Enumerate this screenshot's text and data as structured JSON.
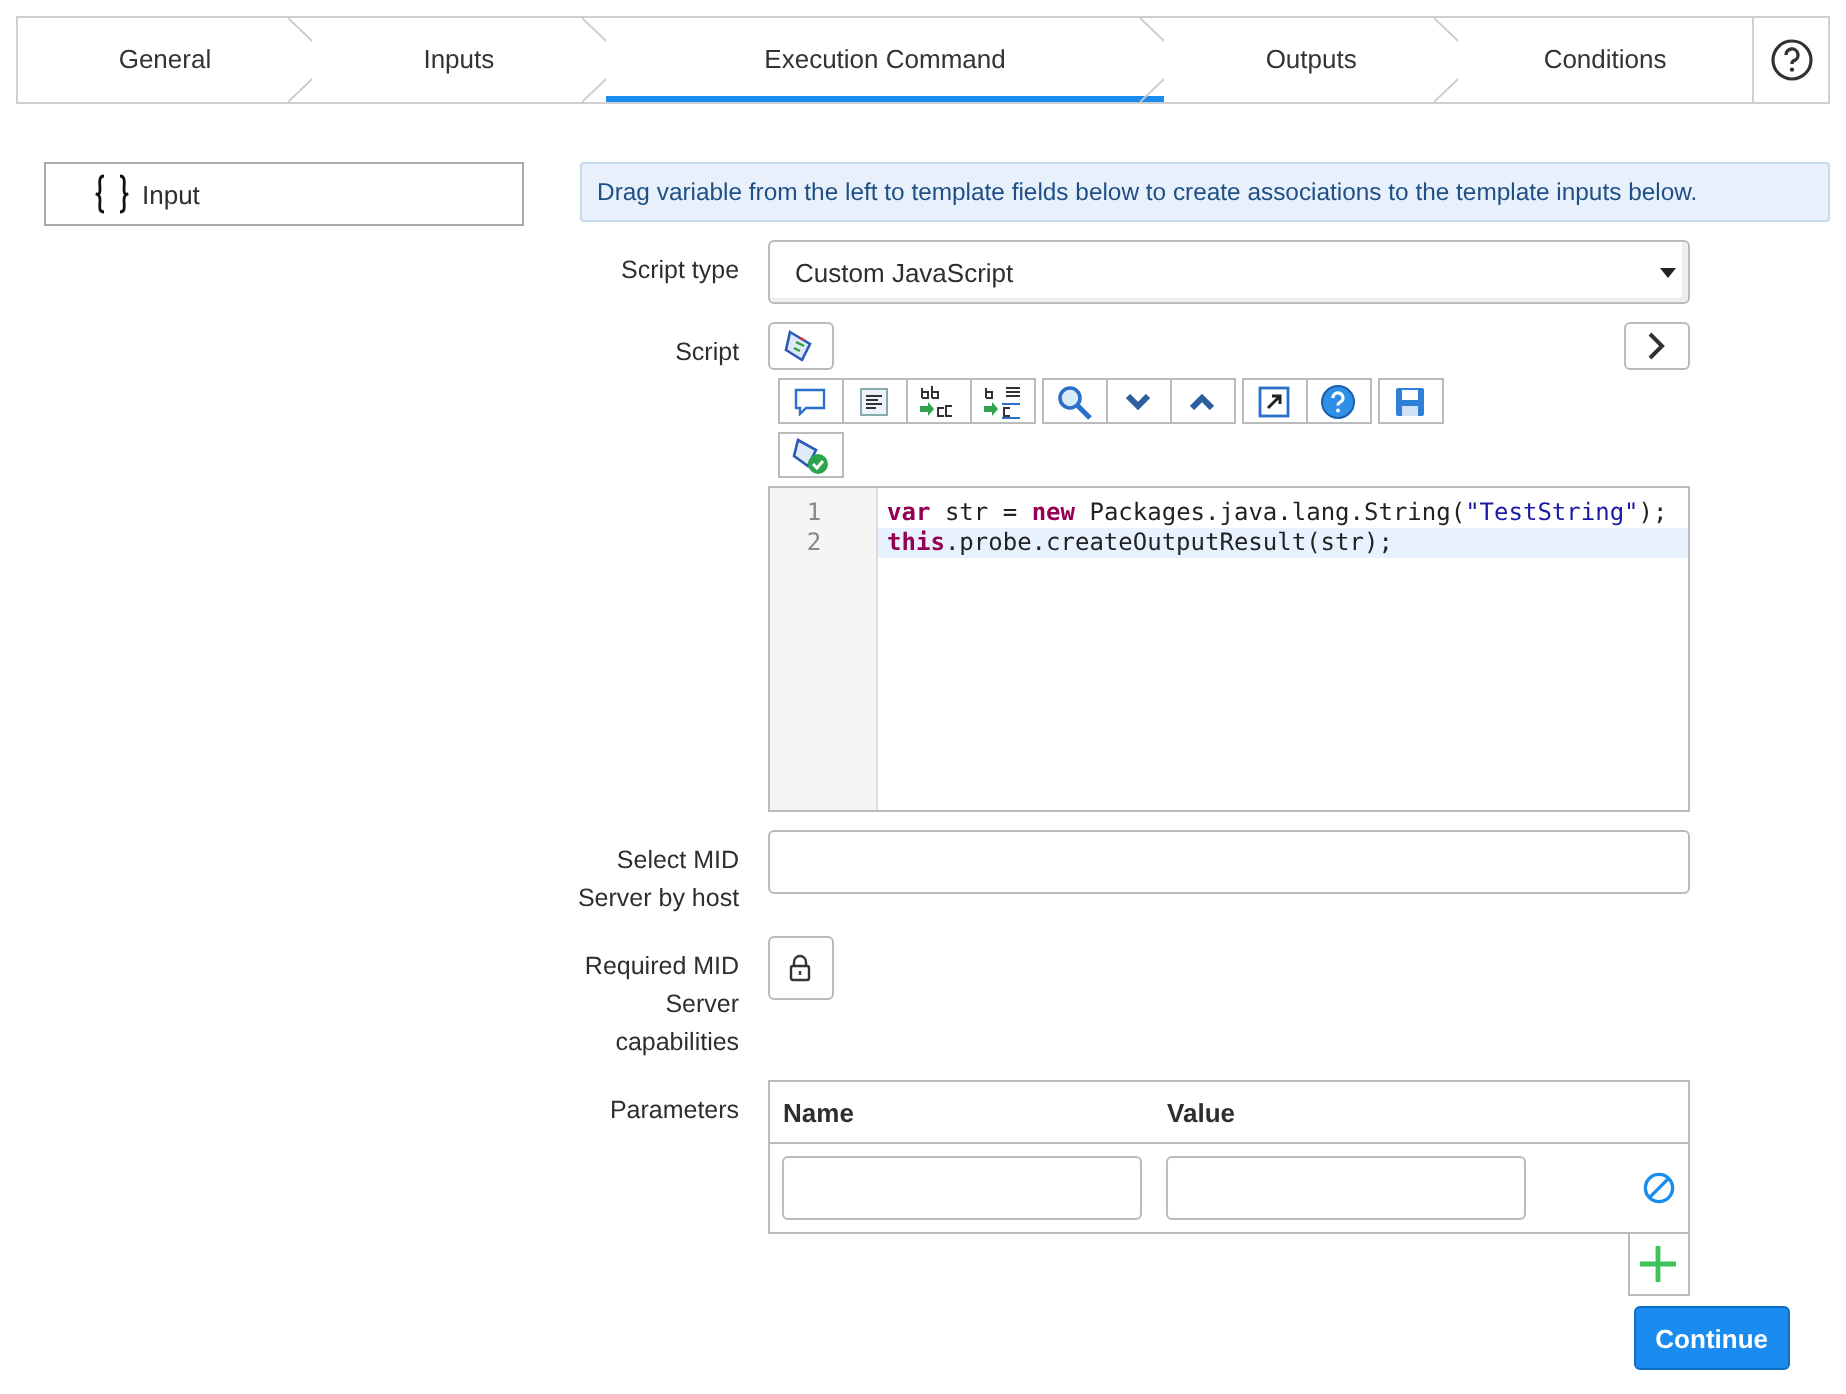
{
  "tabs": [
    {
      "label": "General",
      "selected": false
    },
    {
      "label": "Inputs",
      "selected": false
    },
    {
      "label": "Execution Command",
      "selected": true
    },
    {
      "label": "Outputs",
      "selected": false
    },
    {
      "label": "Conditions",
      "selected": false
    }
  ],
  "variables": [
    {
      "label": "Input"
    }
  ],
  "info_message": "Drag variable from the left to template fields below to create associations to the template inputs below.",
  "form": {
    "script_type": {
      "label": "Script type",
      "value": "Custom JavaScript"
    },
    "script": {
      "label": "Script",
      "lines": [
        {
          "number": "1",
          "selected": false,
          "tokens": [
            {
              "kind": "keyword",
              "text": "var"
            },
            {
              "kind": "plain",
              "text": " str = "
            },
            {
              "kind": "keyword",
              "text": "new"
            },
            {
              "kind": "plain",
              "text": " Packages.java.lang.String("
            },
            {
              "kind": "string",
              "text": "\"TestString\""
            },
            {
              "kind": "plain",
              "text": ");"
            }
          ]
        },
        {
          "number": "2",
          "selected": true,
          "tokens": [
            {
              "kind": "keyword",
              "text": "this"
            },
            {
              "kind": "plain",
              "text": ".probe.createOutputResult(str);"
            }
          ]
        }
      ]
    },
    "mid_server_host": {
      "label": "Select MID Server by host"
    },
    "capabilities": {
      "label": "Required MID Server capabilities"
    },
    "parameters": {
      "label": "Parameters",
      "columns": [
        "Name",
        "Value"
      ],
      "rows": [
        {}
      ]
    }
  },
  "continue_button": "Continue"
}
